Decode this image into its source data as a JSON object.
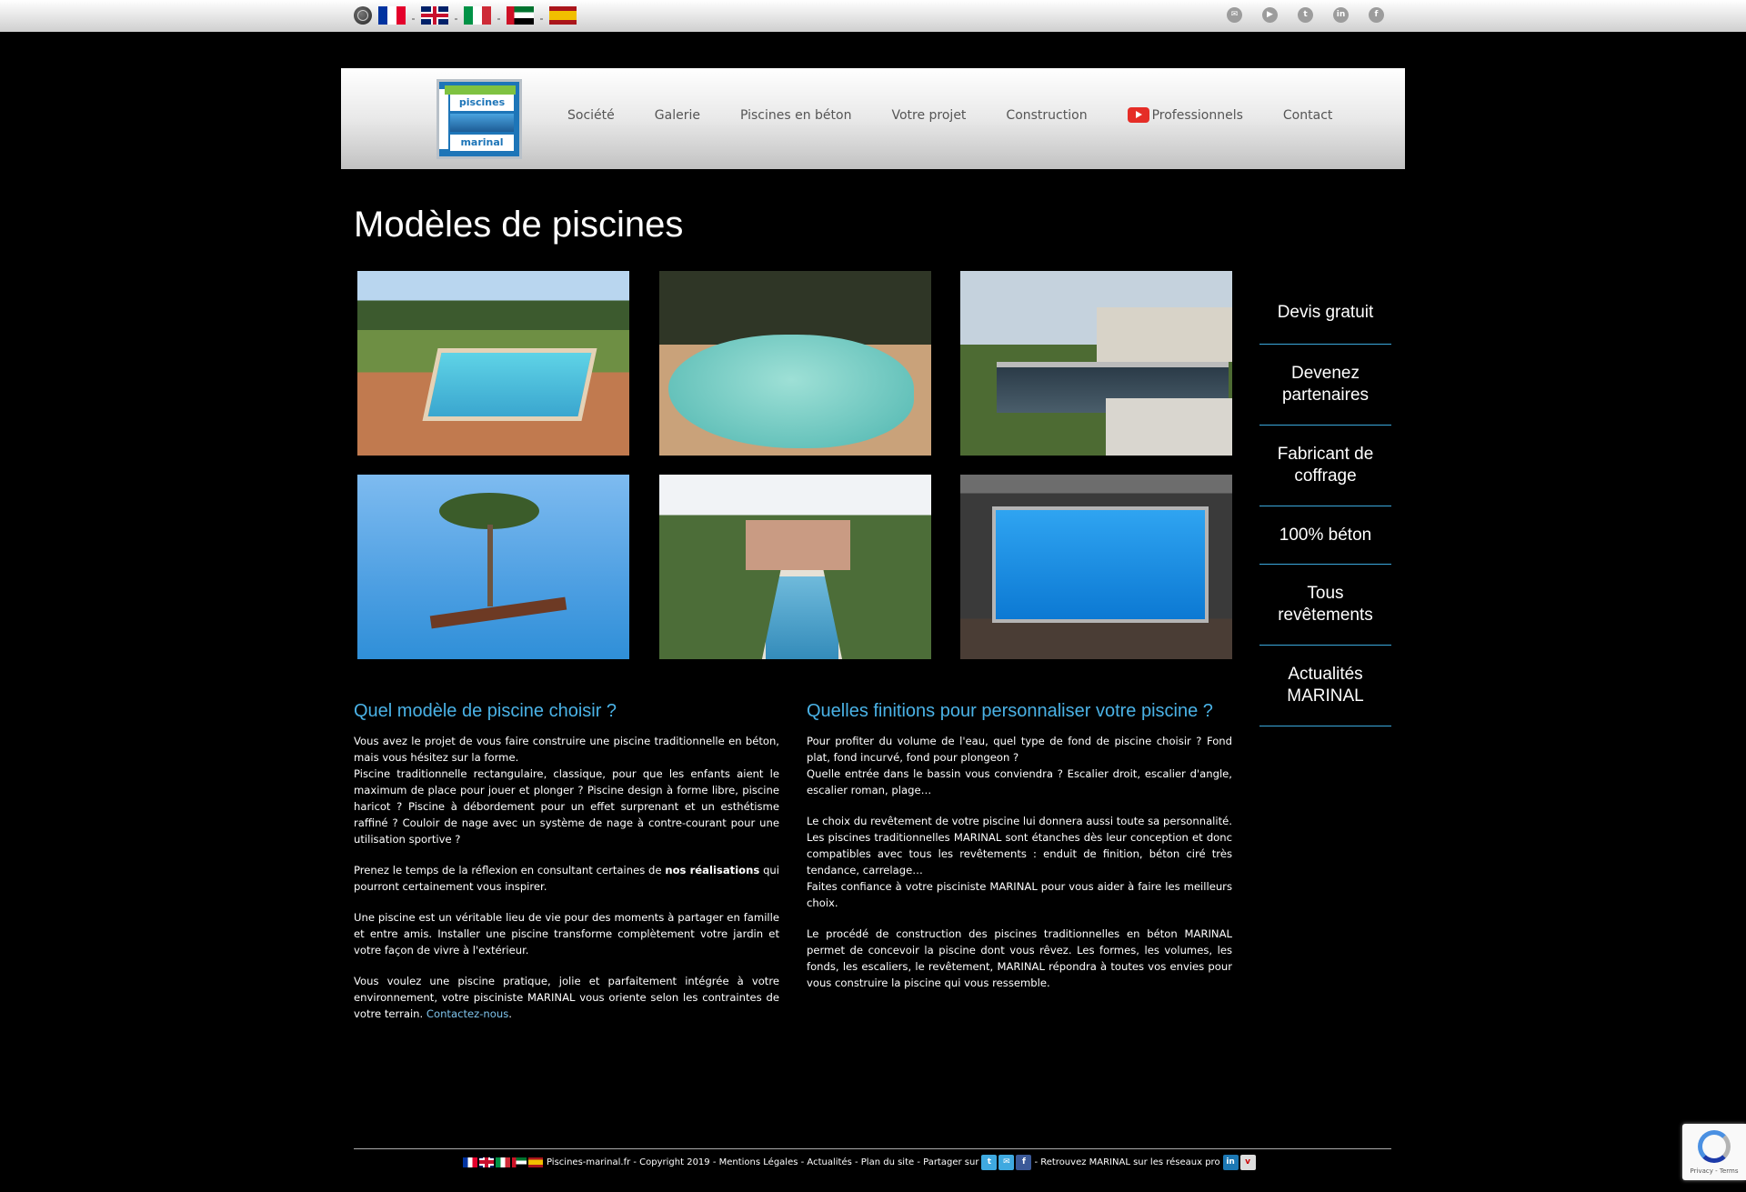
{
  "topbar": {
    "flags": [
      "globe-icon",
      "fr-flag",
      "uk-flag",
      "it-flag",
      "ae-flag",
      "es-flag"
    ],
    "social": [
      "mail-icon",
      "youtube-icon",
      "twitter-icon",
      "linkedin-icon",
      "facebook-icon"
    ]
  },
  "header": {
    "logo": {
      "line1": "piscines",
      "line2": "marinal",
      "side": "BÉTON"
    },
    "nav": [
      "Société",
      "Galerie",
      "Piscines en béton",
      "Votre projet",
      "Construction",
      "Professionnels",
      "Contact"
    ]
  },
  "main": {
    "title": "Modèles de piscines"
  },
  "left": {
    "heading": "Quel modèle de piscine choisir ?",
    "p1a": "Vous avez le projet de vous faire construire une piscine traditionnelle en béton, mais vous hésitez sur la forme.",
    "p1b": "Piscine traditionnelle rectangulaire, classique, pour que les enfants aient le maximum de place pour jouer et plonger ? Piscine design à forme libre, piscine haricot ? Piscine à débordement pour un effet surprenant et un esthétisme raffiné ? Couloir de nage avec un système de nage à contre-courant pour une utilisation sportive ?",
    "p2_pre": "Prenez le temps de la réflexion en consultant certaines de ",
    "p2_link": "nos réalisations",
    "p2_post": " qui pourront certainement vous inspirer.",
    "p3": "Une piscine est un véritable lieu de vie pour des moments à partager en famille et entre amis. Installer une piscine transforme complètement votre jardin et votre façon de vivre à l'extérieur.",
    "p4_pre": "Vous voulez une piscine pratique, jolie et parfaitement intégrée à votre environnement, votre pisciniste MARINAL vous oriente selon les contraintes de votre terrain. ",
    "p4_link": "Contactez-nous",
    "p4_post": "."
  },
  "right": {
    "heading": "Quelles finitions pour personnaliser votre piscine ?",
    "p1a": "Pour profiter du volume de l'eau, quel type de fond de piscine choisir ? Fond plat, fond incurvé, fond pour plongeon ?",
    "p1b": "Quelle entrée dans le bassin vous conviendra ? Escalier droit, escalier d'angle, escalier roman, plage…",
    "p2a": "Le choix du revêtement de votre piscine lui donnera aussi toute sa personnalité. Les piscines traditionnelles MARINAL sont étanches dès leur conception et donc compatibles avec tous les revêtements : enduit de finition, béton ciré très tendance, carrelage…",
    "p2b": "Faites confiance à votre pisciniste MARINAL pour vous aider à faire les meilleurs choix.",
    "p3": "Le procédé de construction des piscines traditionnelles en béton MARINAL permet de concevoir la piscine dont vous rêvez. Les formes, les volumes, les fonds, les escaliers, le revêtement, MARINAL répondra à toutes vos envies pour vous construire la piscine qui vous ressemble."
  },
  "sidebar": [
    "Devis gratuit",
    "Devenez partenaires",
    "Fabricant de coffrage",
    "100% béton",
    "Tous revêtements",
    "Actualités MARINAL"
  ],
  "footer": {
    "text1": "Piscines-marinal.fr - Copyright 2019 - Mentions Légales - Actualités - Plan du site - Partager sur",
    "text2": "- Retrouvez MARINAL sur les réseaux pro"
  },
  "recaptcha": {
    "links": "Privacy - Terms"
  }
}
